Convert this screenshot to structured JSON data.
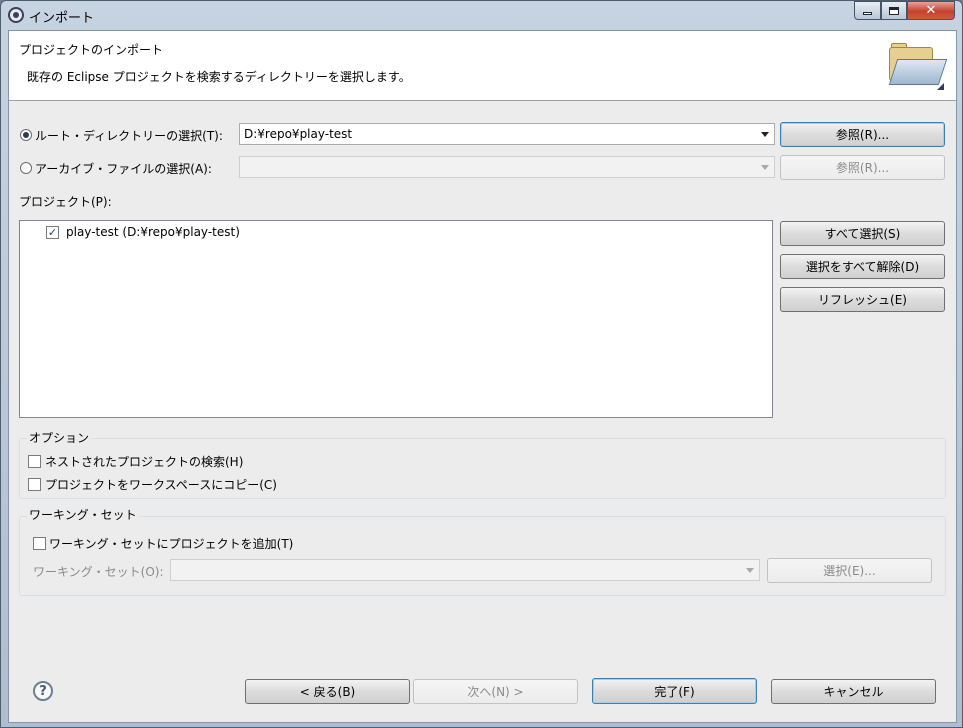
{
  "window": {
    "title": "インポート",
    "controls": {
      "minimize": "minimize",
      "maximize": "maximize",
      "close": "✕"
    }
  },
  "header": {
    "title": "プロジェクトのインポート",
    "description": "既存の Eclipse プロジェクトを検索するディレクトリーを選択します。",
    "icon": "folder-open-icon"
  },
  "source": {
    "root_dir_label": "ルート・ディレクトリーの選択(T):",
    "root_dir_selected": true,
    "root_dir_value": "D:¥repo¥play-test",
    "root_browse_label": "参照(R)...",
    "archive_label": "アーカイブ・ファイルの選択(A):",
    "archive_selected": false,
    "archive_value": "",
    "archive_browse_label": "参照(R)..."
  },
  "projects": {
    "label": "プロジェクト(P):",
    "items": [
      {
        "label": "play-test (D:¥repo¥play-test)",
        "checked": true
      }
    ],
    "select_all_label": "すべて選択(S)",
    "deselect_all_label": "選択をすべて解除(D)",
    "refresh_label": "リフレッシュ(E)"
  },
  "options": {
    "group_label": "オプション",
    "search_nested_label": "ネストされたプロジェクトの検索(H)",
    "search_nested_checked": false,
    "copy_to_workspace_label": "プロジェクトをワークスペースにコピー(C)",
    "copy_to_workspace_checked": false
  },
  "working_sets": {
    "group_label": "ワーキング・セット",
    "add_label": "ワーキング・セットにプロジェクトを追加(T)",
    "add_checked": false,
    "sets_label": "ワーキング・セット(O):",
    "sets_value": "",
    "select_label": "選択(E)..."
  },
  "footer": {
    "help": "?",
    "back_label": "< 戻る(B)",
    "next_label": "次へ(N) >",
    "finish_label": "完了(F)",
    "cancel_label": "キャンセル"
  }
}
